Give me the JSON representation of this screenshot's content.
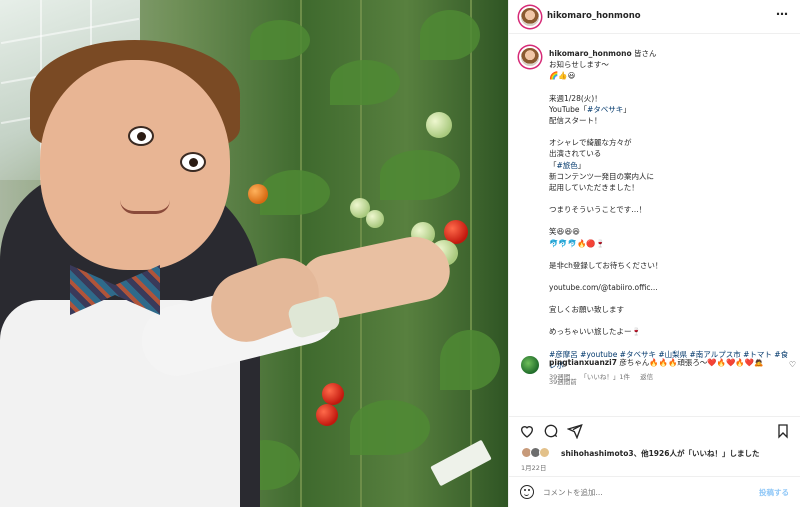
{
  "post": {
    "username": "hikomaro_honmono"
  },
  "caption": {
    "username": "hikomaro_honmono",
    "lines": [
      "皆さん",
      "お知らせします〜",
      "🌈👍😃",
      "",
      "来週1/28(火)！",
      "YouTube「#タベサキ」",
      "配信スタート！",
      "",
      "オシャレで綺麗な方々が",
      "出演されている",
      "「#旅色」",
      "新コンテンツ一発目の案内人に",
      "起用していただきました！",
      "",
      "つまりそういうことです…！",
      "",
      "笑😆😆😆",
      "🐬🐬🐬🔥🔴🍷",
      "",
      "是非ch登録してお待ちください！",
      "",
      "youtube.com/@tabiiro.offic...",
      "",
      "宜しくお願い致します",
      "",
      "めっちゃいい旅したよー🍷"
    ],
    "hashtags": "#彦摩呂 #youtube #タベサキ #山梨県 #南アルプス市 #トマト #食レポ",
    "age": "39週間前"
  },
  "comment": {
    "username": "pingtianxuanzi7",
    "text": "彦ちゃん🔥🔥🔥頑張ろ～❤️🔥❤️🔥❤️🙇",
    "age": "39週間",
    "likes": "「いいね！」1件",
    "reply": "返信"
  },
  "likes": {
    "text": "shihohashimoto3、他1926人が「いいね！」しました"
  },
  "date": "1月22日",
  "composer": {
    "placeholder": "コメントを追加...",
    "post_label": "投稿する"
  },
  "icons": {
    "more": "⋯",
    "heart": "♡",
    "comment": "comment-icon",
    "share": "share-icon",
    "save": "bookmark-icon"
  },
  "colors": {
    "story_ring": "#d62976",
    "link": "#00376b",
    "post_button": "#8fc7f7",
    "muted": "#737373"
  }
}
